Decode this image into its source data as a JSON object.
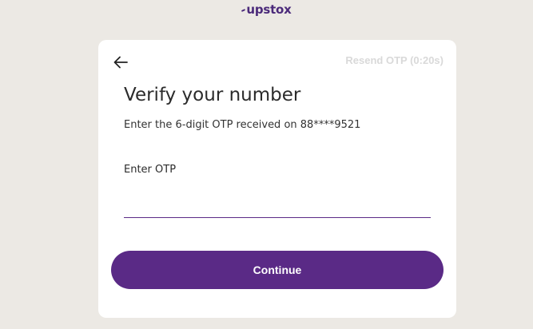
{
  "header": {
    "logo_text": "upstox"
  },
  "card": {
    "back_icon": "arrow-left-icon",
    "resend_label": "Resend OTP (0:20s)",
    "title": "Verify your number",
    "subtitle": "Enter the 6-digit OTP received on 88****9521",
    "otp_label": "Enter OTP",
    "otp_value": "",
    "continue_label": "Continue"
  },
  "colors": {
    "background": "#ece9e4",
    "brand": "#5a2a86",
    "resend_disabled": "#d9d9d9"
  }
}
